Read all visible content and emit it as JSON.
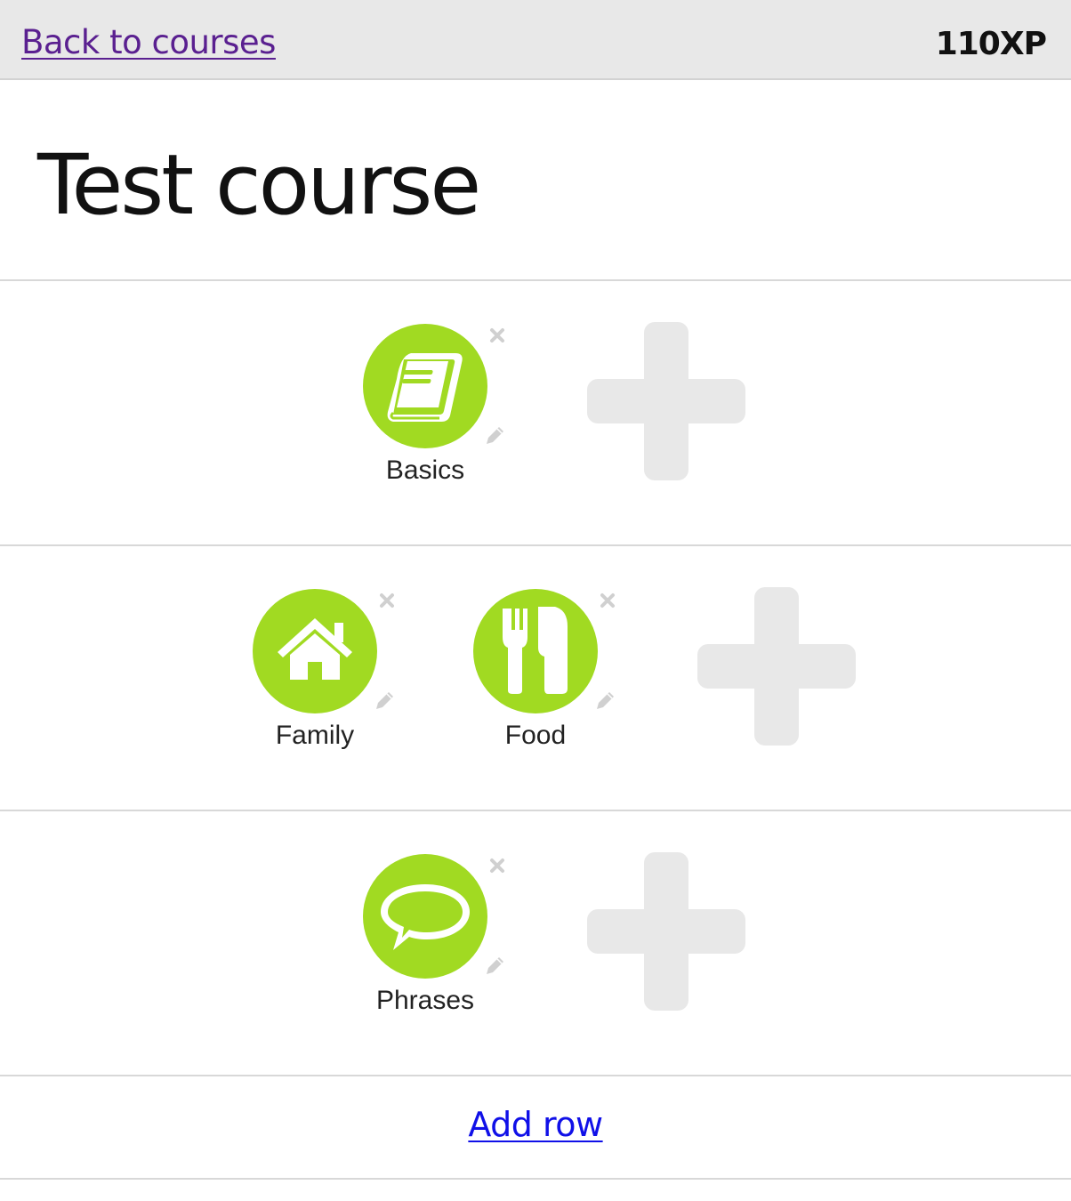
{
  "header": {
    "back_label": "Back to courses",
    "xp_label": "110XP"
  },
  "course": {
    "title": "Test course"
  },
  "rows": [
    {
      "skills": [
        {
          "label": "Basics",
          "icon": "book-icon"
        }
      ]
    },
    {
      "skills": [
        {
          "label": "Family",
          "icon": "house-icon"
        },
        {
          "label": "Food",
          "icon": "fork-knife-icon"
        }
      ]
    },
    {
      "skills": [
        {
          "label": "Phrases",
          "icon": "speech-bubble-icon"
        }
      ]
    }
  ],
  "add_row_label": "Add row",
  "colors": {
    "skill_green": "#a1da22",
    "add_gray": "#e8e8e8",
    "back_link": "#5a2090",
    "add_row_link": "#1010e8"
  }
}
